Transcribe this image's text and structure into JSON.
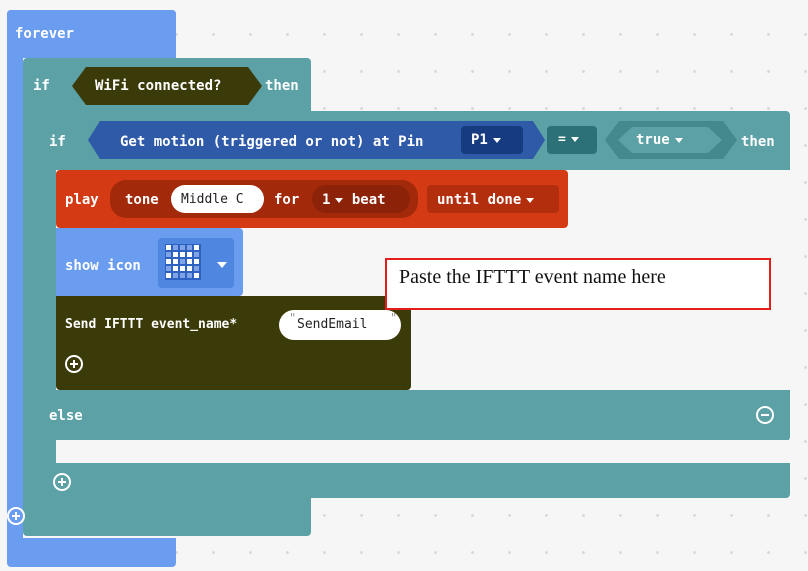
{
  "forever": {
    "label": "forever"
  },
  "if_outer": {
    "if_label": "if",
    "condition": "WiFi connected?",
    "then_label": "then"
  },
  "if_inner": {
    "if_label": "if",
    "motion": {
      "text": "Get motion (triggered or not) at Pin",
      "pin": "P1"
    },
    "operator": "=",
    "value": "true",
    "then_label": "then"
  },
  "play_block": {
    "play_label": "play",
    "tone_label": "tone",
    "note": "Middle C",
    "for_label": "for",
    "beat_value": "1",
    "beat_label": "beat",
    "mode": "until done"
  },
  "show_icon": {
    "label": "show icon"
  },
  "ifttt": {
    "label": "Send IFTTT event_name*",
    "event_name": "SendEmail"
  },
  "else_label": "else",
  "annotation": {
    "text": "Paste the IFTTT event name here"
  },
  "colors": {
    "forever": "#6a9cf0",
    "logic": "#5ba1a6",
    "dark_teal": "#2b7177",
    "motion": "#2e5aa8",
    "music": "#d43b14",
    "ifttt": "#3b3a09",
    "annotation_border": "#e31c1c"
  }
}
